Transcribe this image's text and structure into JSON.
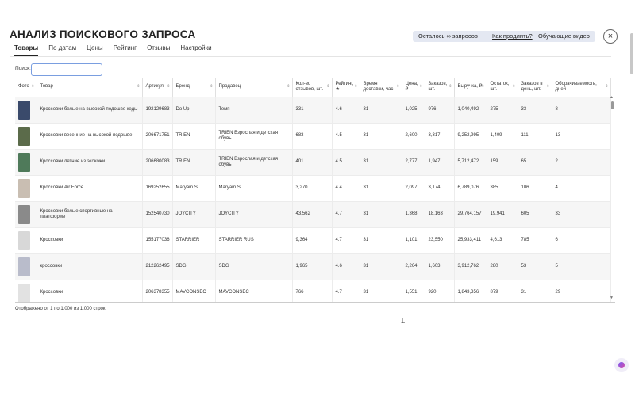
{
  "header": {
    "title": "АНАЛИЗ ПОИСКОВОГО ЗАПРОСА",
    "remaining_label": "Осталось ∞ запросов",
    "extend_link": "Как продлить?",
    "training_button": "Обучающие видео",
    "close_icon": "close-icon"
  },
  "tabs": [
    {
      "label": "Товары",
      "active": true
    },
    {
      "label": "По датам",
      "active": false
    },
    {
      "label": "Цены",
      "active": false
    },
    {
      "label": "Рейтинг",
      "active": false
    },
    {
      "label": "Отзывы",
      "active": false
    },
    {
      "label": "Настройки",
      "active": false
    }
  ],
  "search": {
    "label": "Поиск:",
    "value": "",
    "placeholder": ""
  },
  "table": {
    "columns": [
      "Фото",
      "Товар",
      "Артикул",
      "Бренд",
      "Продавец",
      "Кол-во отзывов, шт.",
      "Рейтинг, ★",
      "Время доставки, час",
      "Цена, ₽",
      "Заказов, шт.",
      "Выручка, ₽",
      "Остаток, шт.",
      "Заказов в день, шт.",
      "Оборачиваемость, дней"
    ],
    "rows": [
      {
        "thumb_color": "#3a4a6b",
        "product": "Кроссовки белые на высокой подошве кеды",
        "article": "192129683",
        "brand": "Do Up",
        "seller": "Темп",
        "reviews": "331",
        "rating": "4.6",
        "delivery": "31",
        "price": "1,025",
        "orders": "976",
        "revenue": "1,040,492",
        "stock": "275",
        "orders_day": "33",
        "turnover": "8"
      },
      {
        "thumb_color": "#5b6b4a",
        "product": "Кроссовки весенние на высокой подошве",
        "article": "206671751",
        "brand": "TRIEN",
        "seller": "TRIEN Взрослая и детская обувь",
        "reviews": "683",
        "rating": "4.5",
        "delivery": "31",
        "price": "2,600",
        "orders": "3,317",
        "revenue": "9,252,995",
        "stock": "1,409",
        "orders_day": "111",
        "turnover": "13"
      },
      {
        "thumb_color": "#4f7a5a",
        "product": "Кроссовки летние из экокожи",
        "article": "206680083",
        "brand": "TRIEN",
        "seller": "TRIEN Взрослая и детская обувь",
        "reviews": "401",
        "rating": "4.5",
        "delivery": "31",
        "price": "2,777",
        "orders": "1,947",
        "revenue": "5,712,472",
        "stock": "159",
        "orders_day": "65",
        "turnover": "2"
      },
      {
        "thumb_color": "#c9beb2",
        "product": "Кроссовки Air Force",
        "article": "169252655",
        "brand": "Maryam S",
        "seller": "Maryam S",
        "reviews": "3,270",
        "rating": "4.4",
        "delivery": "31",
        "price": "2,097",
        "orders": "3,174",
        "revenue": "6,789,076",
        "stock": "385",
        "orders_day": "106",
        "turnover": "4"
      },
      {
        "thumb_color": "#8a8a8a",
        "product": "Кроссовки белые спортивные на платформе",
        "article": "152540730",
        "brand": "JOYCITY",
        "seller": "JOYCITY",
        "reviews": "43,562",
        "rating": "4.7",
        "delivery": "31",
        "price": "1,368",
        "orders": "18,163",
        "revenue": "29,764,157",
        "stock": "19,941",
        "orders_day": "605",
        "turnover": "33"
      },
      {
        "thumb_color": "#d8d8d8",
        "product": "Кроссовки",
        "article": "155177036",
        "brand": "STARRIER",
        "seller": "STARRIER RUS",
        "reviews": "9,364",
        "rating": "4.7",
        "delivery": "31",
        "price": "1,101",
        "orders": "23,550",
        "revenue": "25,933,411",
        "stock": "4,613",
        "orders_day": "785",
        "turnover": "6"
      },
      {
        "thumb_color": "#b9bccb",
        "product": "кроссовки",
        "article": "212262495",
        "brand": "SDG",
        "seller": "SDG",
        "reviews": "1,965",
        "rating": "4.6",
        "delivery": "31",
        "price": "2,264",
        "orders": "1,603",
        "revenue": "3,912,762",
        "stock": "280",
        "orders_day": "53",
        "turnover": "5"
      },
      {
        "thumb_color": "#e2e2e2",
        "product": "Кроссовки",
        "article": "206378355",
        "brand": "MAVCONSEC",
        "seller": "MAVCONSEC",
        "reviews": "766",
        "rating": "4.7",
        "delivery": "31",
        "price": "1,551",
        "orders": "920",
        "revenue": "1,843,356",
        "stock": "879",
        "orders_day": "31",
        "turnover": "29"
      }
    ]
  },
  "footer": {
    "status": "Отображено от 1 по 1,000 из 1,000 строк"
  },
  "icons": {
    "sort": "sort-icon",
    "helper": "helper-bubble-icon"
  }
}
